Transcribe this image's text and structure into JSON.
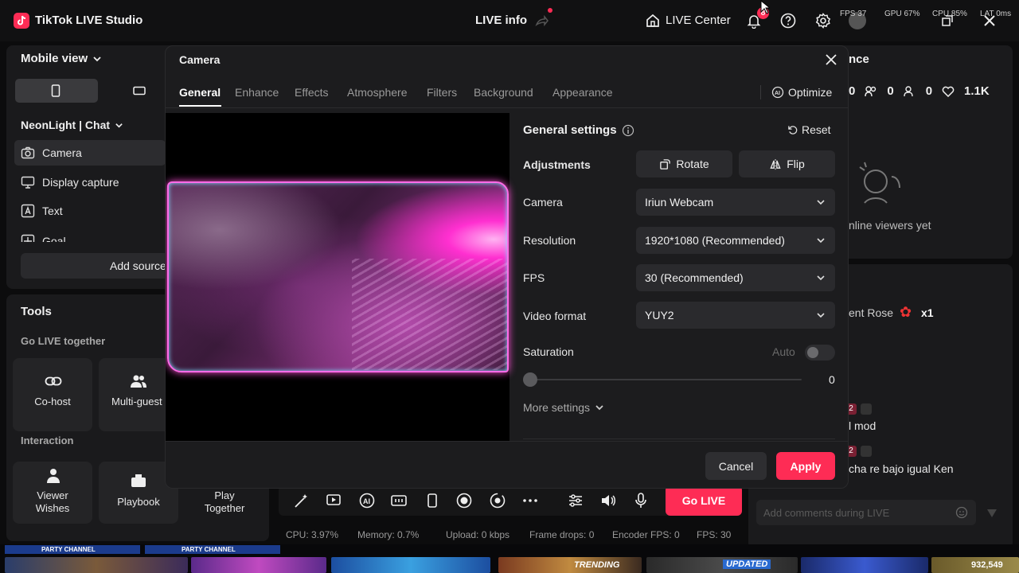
{
  "app": {
    "title": "TikTok LIVE Studio"
  },
  "topbar": {
    "live_info": "LIVE info",
    "live_center": "LIVE Center",
    "notif_count": "8",
    "stats": {
      "fps": "FPS 37",
      "gpu": "GPU 67%",
      "cpu": "CPU 85%",
      "lat": "LAT 0ms"
    }
  },
  "left": {
    "view_mode": "Mobile view",
    "scene": "NeonLight | Chat",
    "sources": [
      {
        "label": "Camera",
        "icon": "camera-icon"
      },
      {
        "label": "Display capture",
        "icon": "monitor-icon"
      },
      {
        "label": "Text",
        "icon": "text-icon"
      },
      {
        "label": "Goal",
        "icon": "goal-icon"
      }
    ],
    "add_source": "Add source",
    "tools_title": "Tools",
    "go_live_together": "Go LIVE together",
    "cohost": "Co-host",
    "multiguest": "Multi-guest",
    "interaction": "Interaction",
    "viewer_wishes": "Viewer Wishes",
    "playbook": "Playbook",
    "play_together": "Play Together"
  },
  "right": {
    "title_partial": "nce",
    "counts": {
      "a": "0",
      "b": "0",
      "c": "0",
      "likes": "1.1K"
    },
    "no_viewers": "nline viewers yet",
    "gift_name": "ent Rose",
    "gift_mult": "x1",
    "comment_badge1": "2",
    "comment1": "l mod",
    "comment_badge2": "2",
    "comment2": "cha re bajo igual Ken",
    "comment_placeholder": "Add comments during LIVE"
  },
  "modal": {
    "title": "Camera",
    "tabs": [
      "General",
      "Enhance",
      "Effects",
      "Atmosphere",
      "Filters",
      "Background",
      "Appearance"
    ],
    "optimize": "Optimize",
    "general_settings": "General settings",
    "reset": "Reset",
    "adjustments": "Adjustments",
    "rotate": "Rotate",
    "flip": "Flip",
    "camera_label": "Camera",
    "camera_value": "Iriun Webcam",
    "resolution_label": "Resolution",
    "resolution_value": "1920*1080 (Recommended)",
    "fps_label": "FPS",
    "fps_value": "30 (Recommended)",
    "video_format_label": "Video format",
    "video_format_value": "YUY2",
    "saturation_label": "Saturation",
    "auto_label": "Auto",
    "saturation_value": "0",
    "more_settings": "More settings",
    "cancel": "Cancel",
    "apply": "Apply"
  },
  "bottom": {
    "go_live": "Go LIVE",
    "cpu": "CPU: 3.97%",
    "memory": "Memory: 0.7%",
    "upload": "Upload: 0 kbps",
    "frame_drops": "Frame drops: 0",
    "encoder_fps": "Encoder FPS: 0",
    "fps": "FPS: 30"
  },
  "taskbar": {
    "party1": "PARTY CHANNEL",
    "party2": "PARTY CHANNEL",
    "trending": "TRENDING",
    "updated": "UPDATED",
    "count": "932,549"
  },
  "colors": {
    "accent": "#fe2c55",
    "bg": "#0c0c0d",
    "panel": "#1a1a1c",
    "modal": "#1c1c1e"
  }
}
